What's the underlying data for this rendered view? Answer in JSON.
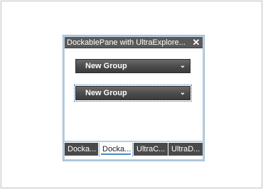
{
  "pane": {
    "title": "DockablePane with UltraExplore..."
  },
  "groups": [
    {
      "label": "New Group",
      "icon": "chevron-down-icon"
    },
    {
      "label": "New Group",
      "icon": "chevron-down-icon"
    }
  ],
  "tabs": [
    {
      "label": "Docka..."
    },
    {
      "label": "Docka..."
    },
    {
      "label": "UltraC..."
    },
    {
      "label": "UltraD..."
    }
  ],
  "colors": {
    "header_dark": "#4a4a4a",
    "pane_border": "#b9cfe3",
    "active_tab_underline": "#4a86c8"
  }
}
